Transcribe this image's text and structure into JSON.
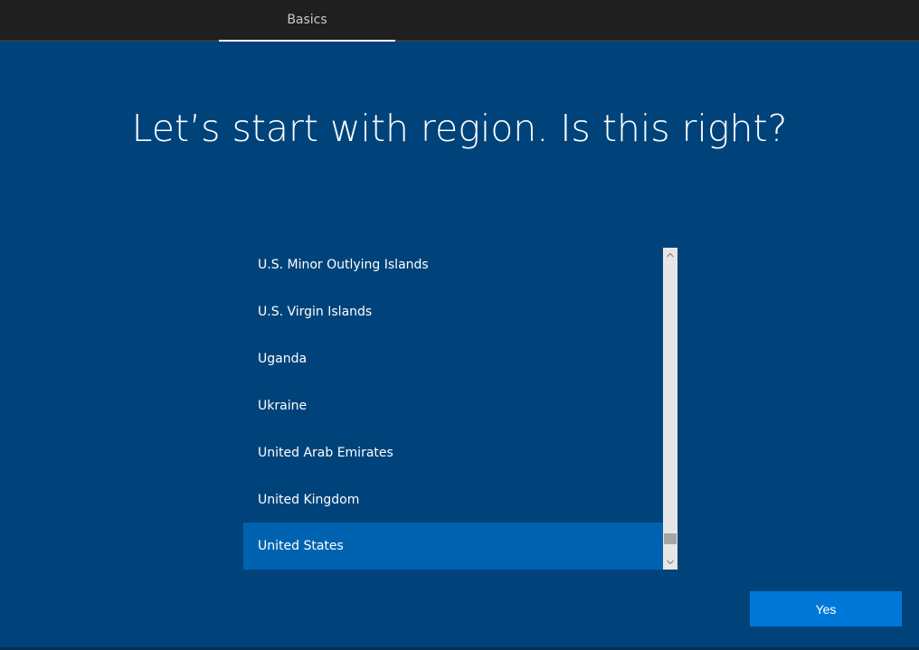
{
  "header": {
    "tab_label": "Basics"
  },
  "main": {
    "title": "Let’s start with region. Is this right?"
  },
  "region_list": {
    "items": [
      "U.S. Minor Outlying Islands",
      "U.S. Virgin Islands",
      "Uganda",
      "Ukraine",
      "United Arab Emirates",
      "United Kingdom",
      "United States"
    ],
    "selected": "United States"
  },
  "footer": {
    "yes_label": "Yes"
  },
  "colors": {
    "background": "#00437a",
    "selected_item": "#0063b1",
    "button": "#0078d7",
    "topbar": "#1f1f1f"
  },
  "icons": {
    "scroll_up": "chevron-up-icon",
    "scroll_down": "chevron-down-icon"
  }
}
